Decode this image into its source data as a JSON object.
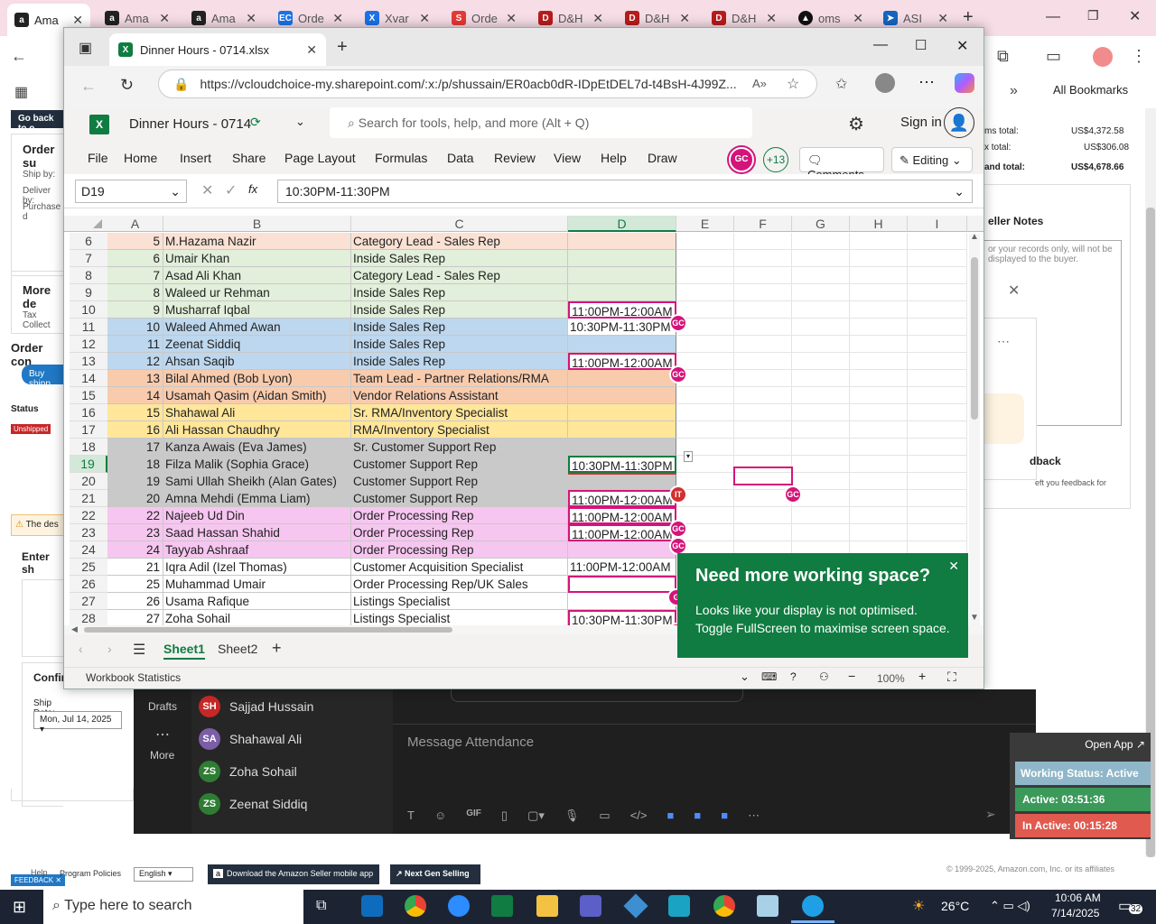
{
  "outer_tabs": [
    {
      "label": "Ama",
      "icon": "amazon-icon",
      "color": "#222"
    },
    {
      "label": "Ama",
      "icon": "amazon-icon",
      "color": "#222"
    },
    {
      "label": "Ama",
      "icon": "amazon-icon",
      "color": "#222"
    },
    {
      "label": "Orde",
      "icon": "ec-icon",
      "color": "#1a73e8"
    },
    {
      "label": "Xvar",
      "icon": "xvar-icon",
      "color": "#1a73e8"
    },
    {
      "label": "Orde",
      "icon": "order-icon",
      "color": "#e53935"
    },
    {
      "label": "D&H",
      "icon": "dh-icon",
      "color": "#b71c1c"
    },
    {
      "label": "D&H",
      "icon": "dh-icon",
      "color": "#b71c1c"
    },
    {
      "label": "D&H",
      "icon": "dh-icon",
      "color": "#b71c1c"
    },
    {
      "label": "oms",
      "icon": "oms-icon",
      "color": "#111"
    },
    {
      "label": "ASI",
      "icon": "asi-icon",
      "color": "#1565c0"
    }
  ],
  "outer_bookmarks": "All Bookmarks",
  "amazon_left": {
    "back": "Go back to o",
    "order_summary": "Order su",
    "ship_by": "Ship by:",
    "deliver_by": "Deliver by:",
    "purchase": "Purchase d",
    "more_details": "More de",
    "tax": "Tax Collect",
    "order_contents": "Order con",
    "buy_shipping": "Buy shipp",
    "status": "Status",
    "unshipped": "Unshipped",
    "warning": "The des",
    "enter_ship": "Enter sh",
    "confirm": "Confir",
    "ship_date_label": "Ship Date:",
    "ship_date": "Mon, Jul 14, 2025"
  },
  "amazon_right": {
    "items_total_label": "ms total:",
    "items_total": "US$4,372.58",
    "tax_total_label": "x total:",
    "tax_total": "US$306.08",
    "grand_total_label": "and total:",
    "grand_total": "US$4,678.66",
    "seller_notes": "eller Notes",
    "notes_placeholder": "or your records only, will not be displayed to the buyer.",
    "feedback": "dback",
    "feedback_sub": "eft you feedback for"
  },
  "amazon_bottom": {
    "help": "Help",
    "program_policies": "Program Policies",
    "language": "English",
    "download_app": "Download the Amazon Seller mobile app",
    "next_gen": "Next Gen Selling",
    "feedback": "FEEDBACK",
    "copyright": "© 1999-2025, Amazon.com, Inc. or its affiliates"
  },
  "browser": {
    "tab_title": "Dinner Hours - 0714.xlsx",
    "url": "https://vcloudchoice-my.sharepoint.com/:x:/p/shussain/ER0acb0dR-IDpEtDEL7d-t4BsH-4J99Z..."
  },
  "excel": {
    "file_name": "Dinner Hours - 0714",
    "search_placeholder": "Search for tools, help, and more (Alt + Q)",
    "sign_in": "Sign in",
    "menu": [
      "File",
      "Home",
      "Insert",
      "Share",
      "Page Layout",
      "Formulas",
      "Data",
      "Review",
      "View",
      "Help",
      "Draw"
    ],
    "presence_initials": "GC",
    "presence_more": "+13",
    "comments": "Comments",
    "editing": "Editing",
    "name_box": "D19",
    "fx": "fx",
    "formula": "10:30PM-11:30PM",
    "columns": [
      "A",
      "B",
      "C",
      "D",
      "E",
      "F",
      "G",
      "H",
      "I"
    ],
    "rows": [
      {
        "n": "6",
        "a": "5",
        "b": "M.Hazama Nazir",
        "c": "Category Lead - Sales Rep",
        "d": "",
        "color": "#fbe1d4"
      },
      {
        "n": "7",
        "a": "6",
        "b": "Umair Khan",
        "c": "Inside Sales Rep",
        "d": "",
        "color": "#e2efda"
      },
      {
        "n": "8",
        "a": "7",
        "b": "Asad Ali Khan",
        "c": "Category Lead - Sales Rep",
        "d": "",
        "color": "#e2efda"
      },
      {
        "n": "9",
        "a": "8",
        "b": "Waleed ur Rehman",
        "c": "Inside Sales Rep",
        "d": "",
        "color": "#e2efda"
      },
      {
        "n": "10",
        "a": "9",
        "b": "Musharraf Iqbal",
        "c": "Inside Sales Rep",
        "d": "11:00PM-12:00AM",
        "color": "#e2efda"
      },
      {
        "n": "11",
        "a": "10",
        "b": "Waleed Ahmed Awan",
        "c": "Inside Sales Rep",
        "d": "10:30PM-11:30PM",
        "color": "#bdd7ee"
      },
      {
        "n": "12",
        "a": "11",
        "b": "Zeenat Siddiq",
        "c": "Inside Sales Rep",
        "d": "",
        "color": "#bdd7ee"
      },
      {
        "n": "13",
        "a": "12",
        "b": "Ahsan Saqib",
        "c": "Inside Sales Rep",
        "d": "11:00PM-12:00AM",
        "color": "#bdd7ee"
      },
      {
        "n": "14",
        "a": "13",
        "b": "Bilal Ahmed (Bob Lyon)",
        "c": "Team Lead - Partner Relations/RMA",
        "d": "",
        "color": "#f8cbad"
      },
      {
        "n": "15",
        "a": "14",
        "b": "Usamah Qasim (Aidan Smith)",
        "c": "Vendor Relations Assistant",
        "d": "",
        "color": "#f8cbad"
      },
      {
        "n": "16",
        "a": "15",
        "b": "Shahawal Ali",
        "c": "Sr. RMA/Inventory Specialist",
        "d": "",
        "color": "#ffe699"
      },
      {
        "n": "17",
        "a": "16",
        "b": "Ali Hassan Chaudhry",
        "c": "RMA/Inventory Specialist",
        "d": "",
        "color": "#ffe699"
      },
      {
        "n": "18",
        "a": "17",
        "b": "Kanza Awais (Eva James)",
        "c": "Sr. Customer Support Rep",
        "d": "",
        "color": "#c9c9c9"
      },
      {
        "n": "19",
        "a": "18",
        "b": "Filza Malik (Sophia Grace)",
        "c": "Customer Support Rep",
        "d": "10:30PM-11:30PM",
        "color": "#c9c9c9"
      },
      {
        "n": "20",
        "a": "19",
        "b": "Sami Ullah Sheikh (Alan Gates)",
        "c": "Customer Support Rep",
        "d": "",
        "color": "#c9c9c9"
      },
      {
        "n": "21",
        "a": "20",
        "b": "Amna Mehdi (Emma Liam)",
        "c": "Customer Support Rep",
        "d": "11:00PM-12:00AM",
        "color": "#c9c9c9"
      },
      {
        "n": "22",
        "a": "22",
        "b": "Najeeb Ud Din",
        "c": "Order Processing Rep",
        "d": "11:00PM-12:00AM",
        "color": "#f6c6f0"
      },
      {
        "n": "23",
        "a": "23",
        "b": "Saad Hassan Shahid",
        "c": "Order Processing Rep",
        "d": "11:00PM-12:00AM",
        "color": "#f6c6f0"
      },
      {
        "n": "24",
        "a": "24",
        "b": "Tayyab Ashraaf",
        "c": "Order Processing Rep",
        "d": "",
        "color": "#f6c6f0"
      },
      {
        "n": "25",
        "a": "21",
        "b": "Iqra Adil (Izel Thomas)",
        "c": "Customer Acquisition Specialist",
        "d": "11:00PM-12:00AM",
        "color": "#ffffff"
      },
      {
        "n": "26",
        "a": "25",
        "b": "Muhammad Umair",
        "c": "Order Processing Rep/UK Sales",
        "d": "",
        "color": "#ffffff"
      },
      {
        "n": "27",
        "a": "26",
        "b": "Usama Rafique",
        "c": "Listings Specialist",
        "d": "",
        "color": "#ffffff"
      },
      {
        "n": "28",
        "a": "27",
        "b": "Zoha Sohail",
        "c": "Listings Specialist",
        "d": "10:30PM-11:30PM",
        "color": "#ffffff"
      }
    ],
    "sheets": [
      "Sheet1",
      "Sheet2"
    ],
    "workbook_stats": "Workbook Statistics",
    "zoom": "100%",
    "toast_title": "Need more working space?",
    "toast_body": "Looks like your display is not optimised. Toggle FullScreen to maximise screen space.",
    "collab_badges": [
      "GC",
      "GC",
      "IT",
      "GC",
      "GC",
      "G",
      "G",
      "GC",
      "SH"
    ]
  },
  "chat": {
    "drafts": "Drafts",
    "more": "More",
    "people": [
      {
        "initials": "SH",
        "name": "Sajjad Hussain",
        "color": "#c62828"
      },
      {
        "initials": "SA",
        "name": "Shahawal Ali",
        "color": "#7b5ea7"
      },
      {
        "initials": "ZS",
        "name": "Zoha Sohail",
        "color": "#2e7d32"
      },
      {
        "initials": "ZS",
        "name": "Zeenat Siddiq",
        "color": "#2e7d32"
      }
    ],
    "message_placeholder": "Message Attendance"
  },
  "status_widget": {
    "open_app": "Open App",
    "working": "Working Status: Active",
    "active": "Active: 03:51:36",
    "inactive": "In Active: 00:15:28"
  },
  "taskbar": {
    "search": "Type here to search",
    "temp": "26°C",
    "time": "10:06 AM",
    "date": "7/14/2025",
    "notif": "32"
  }
}
